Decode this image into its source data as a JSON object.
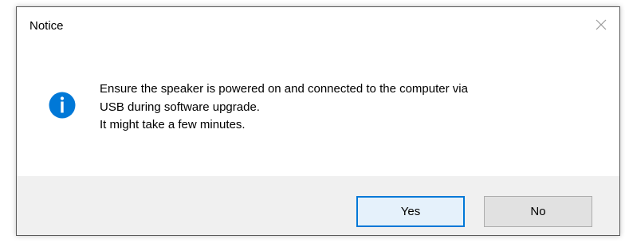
{
  "dialog": {
    "title": "Notice",
    "message_lines": [
      "Ensure the speaker is powered on and connected to the computer via",
      "USB during software upgrade.",
      "It might take a few minutes."
    ],
    "icon": "info-icon",
    "buttons": {
      "yes_label": "Yes",
      "no_label": "No"
    }
  },
  "colors": {
    "info_icon": "#0078d7",
    "default_button_border": "#0078d7",
    "footer_background": "#f0f0f0"
  }
}
